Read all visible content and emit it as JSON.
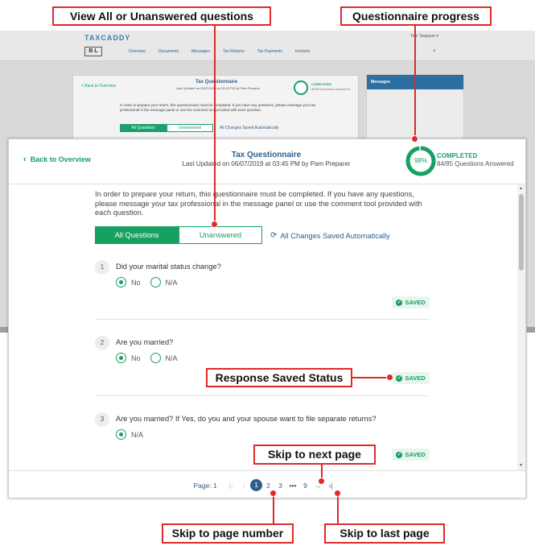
{
  "background_app": {
    "logo": "TAXCADDY",
    "user": "Tom Taxpayer ▾",
    "brand_initials": "B L",
    "nav": [
      "Overview",
      "Documents",
      "Messages",
      "Tax Returns",
      "Tax Payments",
      "Invoices"
    ],
    "card_title": "Tax Questionnaire",
    "card_subtitle": "Last Updated on 06/07/2019 at 03:45 PM by Pam Preparer",
    "card_back": "< Back to Overview",
    "card_completed": "COMPLETED",
    "card_answered": "84/85 Questions Answered",
    "card_intro": "In order to prepare your return, this questionnaire must be completed. If you have any questions, please message your tax professional in the message panel or use the comment tool provided with each question.",
    "card_tab_all": "All Questions",
    "card_tab_unanswered": "Unanswered",
    "card_autosave": "All Changes Saved Automatically",
    "messages_header": "Messages"
  },
  "header": {
    "back_label": "Back to Overview",
    "title": "Tax Questionnaire",
    "updated": "Last Updated on 06/07/2019 at 03:45 PM by Pam Preparer",
    "progress_percent": 98,
    "progress_label": "98%",
    "status": "COMPLETED",
    "answered": "84/85 Questions Answered"
  },
  "intro": "In order to prepare your return, this questionnaire must be completed. If you have any questions, please message your tax professional in the message panel or use the comment tool provided with each question.",
  "tabs": {
    "all": "All Questions",
    "unanswered": "Unanswered",
    "autosave": "All Changes Saved Automatically"
  },
  "questions": [
    {
      "num": "1",
      "text": "Did your marital status change?",
      "options": [
        "No",
        "N/A"
      ],
      "selected": 0,
      "saved": "SAVED"
    },
    {
      "num": "2",
      "text": "Are you married?",
      "options": [
        "No",
        "N/A"
      ],
      "selected": 0,
      "saved": "SAVED"
    },
    {
      "num": "3",
      "text": "Are you married? If Yes, do you and your spouse want to file separate returns?",
      "options": [
        "N/A"
      ],
      "selected": 0,
      "saved": "SAVED"
    }
  ],
  "pager": {
    "label": "Page: 1",
    "first": "|‹",
    "prev": "‹",
    "pages": [
      "1",
      "2",
      "3"
    ],
    "ellipsis": "•••",
    "last_page": "9",
    "next": "→",
    "last": "›|"
  },
  "callouts": {
    "view_all": "View All or Unanswered questions",
    "progress": "Questionnaire progress",
    "saved_status": "Response Saved Status",
    "next_page": "Skip to next page",
    "page_number": "Skip to page number",
    "last_page": "Skip to last page"
  },
  "colors": {
    "accent_green": "#16a062",
    "brand_blue": "#2d5f8a",
    "callout_red": "#e02a2a"
  }
}
